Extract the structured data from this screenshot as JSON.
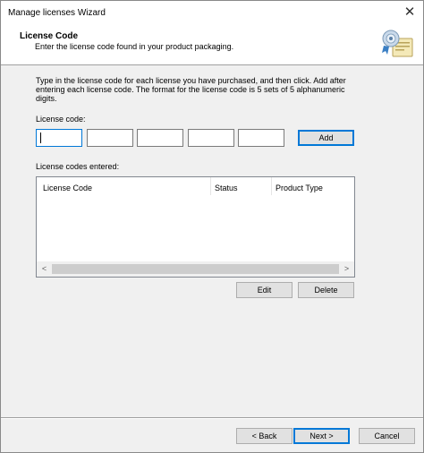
{
  "window": {
    "title": "Manage licenses Wizard",
    "close_glyph": "✕"
  },
  "header": {
    "title": "License Code",
    "subtitle": "Enter the license code found in your product packaging.",
    "icon": "license-certificate-icon"
  },
  "body": {
    "instructions": "Type in the license code for each license you have purchased, and then click. Add after entering each license code. The format for the license code is 5 sets of 5 alphanumeric digits.",
    "license_code_label": "License code:",
    "code_fields": [
      "",
      "",
      "",
      "",
      ""
    ],
    "add_label": "Add",
    "entered_label": "License codes entered:",
    "columns": [
      "License Code",
      "Status",
      "Product Type"
    ],
    "rows": [],
    "scroll_left": "<",
    "scroll_right": ">",
    "edit_label": "Edit",
    "delete_label": "Delete"
  },
  "footer": {
    "back_label": "< Back",
    "next_label": "Next >",
    "cancel_label": "Cancel"
  }
}
